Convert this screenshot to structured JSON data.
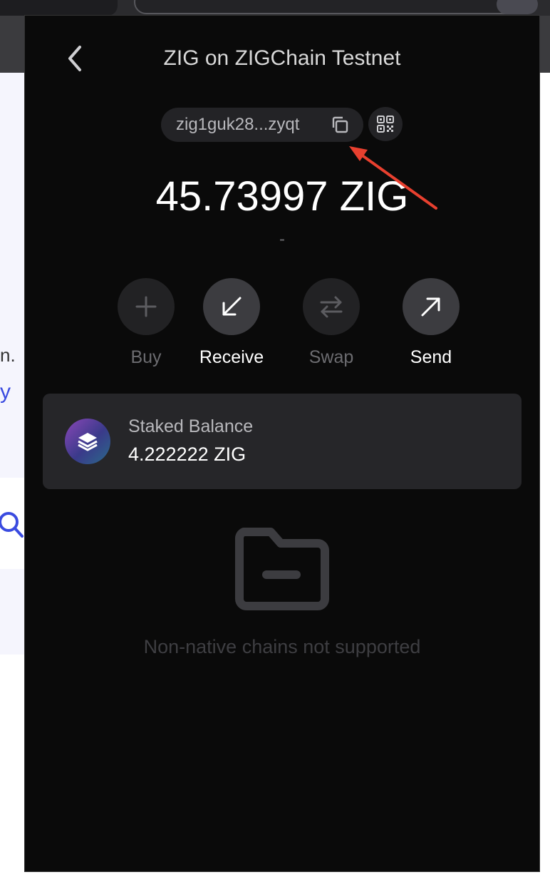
{
  "background_page": {
    "text_fragment_1": "n.",
    "text_fragment_2": "y"
  },
  "wallet": {
    "title": "ZIG on ZIGChain Testnet",
    "address_short": "zig1guk28...zyqt",
    "balance": "45.73997 ZIG",
    "fiat_value": "-",
    "actions": [
      {
        "label": "Buy",
        "icon": "plus-icon",
        "enabled": false
      },
      {
        "label": "Receive",
        "icon": "arrow-down-left-icon",
        "enabled": true
      },
      {
        "label": "Swap",
        "icon": "swap-arrows-icon",
        "enabled": false
      },
      {
        "label": "Send",
        "icon": "arrow-up-right-icon",
        "enabled": true
      }
    ],
    "staked": {
      "label": "Staked Balance",
      "value": "4.222222 ZIG",
      "icon": "layers-icon"
    },
    "empty_state": {
      "icon": "folder-minus-icon",
      "text": "Non-native chains not supported"
    }
  },
  "colors": {
    "popup_bg": "#0a0a0a",
    "card_bg": "#262629",
    "annotation_arrow": "#e8402f",
    "link_blue": "#3a4be0"
  }
}
